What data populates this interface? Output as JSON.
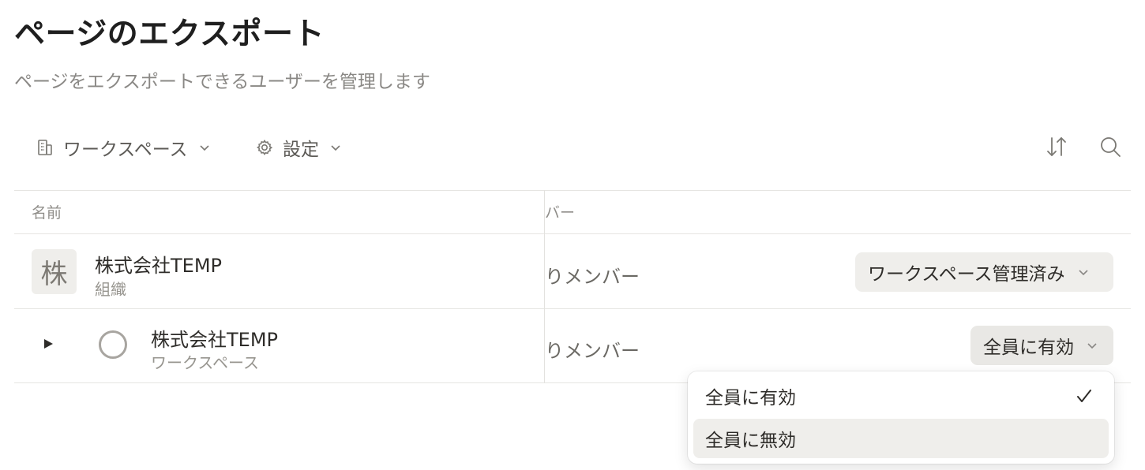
{
  "page": {
    "title": "ページのエクスポート",
    "subtitle": "ページをエクスポートできるユーザーを管理します"
  },
  "toolbar": {
    "workspace_label": "ワークスペース",
    "workspace_icon": "building-icon",
    "settings_label": "設定",
    "settings_icon": "gear-icon",
    "sort_icon": "sort-arrows-icon",
    "search_icon": "search-icon"
  },
  "table": {
    "columns": [
      "名前",
      "バー"
    ],
    "rows": [
      {
        "avatar_char": "株",
        "name": "株式会社TEMP",
        "type": "組織",
        "members": "りメンバー",
        "setting": "ワークスペース管理済み"
      },
      {
        "name": "株式会社TEMP",
        "type": "ワークスペース",
        "members": "りメンバー",
        "setting": "全員に有効"
      }
    ]
  },
  "dropdown": {
    "options": [
      {
        "label": "全員に有効",
        "selected": true,
        "checkmark": "✓"
      },
      {
        "label": "全員に無効",
        "selected": false
      }
    ]
  },
  "colors": {
    "pill_bg": "#efeeeb",
    "text_primary": "#2e2c29",
    "text_muted": "#8a8885",
    "border": "#e6e5e2"
  }
}
